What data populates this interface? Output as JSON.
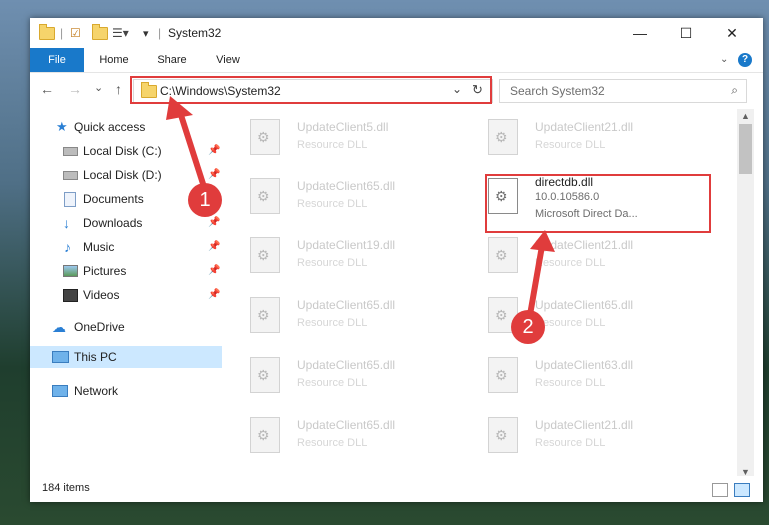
{
  "window": {
    "title": "System32"
  },
  "controls": {
    "minimize": "—",
    "maximize": "☐",
    "close": "✕"
  },
  "ribbon": {
    "tabs": [
      "File",
      "Home",
      "Share",
      "View"
    ],
    "help": "?"
  },
  "nav": {
    "back": "←",
    "forward": "→",
    "recent": "⌄",
    "up": "↑"
  },
  "address": {
    "path": "C:\\Windows\\System32"
  },
  "search": {
    "placeholder": "Search System32"
  },
  "sidebar": {
    "items": [
      {
        "label": "Quick access",
        "icon": "star-icon"
      },
      {
        "label": "Local Disk (C:)",
        "icon": "drive-icon"
      },
      {
        "label": "Local Disk (D:)",
        "icon": "drive-icon"
      },
      {
        "label": "Documents",
        "icon": "documents-icon"
      },
      {
        "label": "Downloads",
        "icon": "download-icon"
      },
      {
        "label": "Music",
        "icon": "music-icon"
      },
      {
        "label": "Pictures",
        "icon": "pictures-icon"
      },
      {
        "label": "Videos",
        "icon": "videos-icon"
      },
      {
        "label": "OneDrive",
        "icon": "cloud-icon"
      },
      {
        "label": "This PC",
        "icon": "computer-icon"
      },
      {
        "label": "Network",
        "icon": "network-icon"
      }
    ]
  },
  "files": {
    "left": [
      {
        "name": "UpdateClient5.dll",
        "desc": "Resource DLL"
      },
      {
        "name": "UpdateClient65.dll",
        "desc": "Resource DLL"
      },
      {
        "name": "UpdateClient19.dll",
        "desc": "Resource DLL"
      },
      {
        "name": "UpdateClient65.dll",
        "desc": "Resource DLL"
      },
      {
        "name": "UpdateClient65.dll",
        "desc": "Resource DLL"
      },
      {
        "name": "UpdateClient65.dll",
        "desc": "Resource DLL"
      }
    ],
    "right": [
      {
        "name": "UpdateClient21.dll",
        "desc": "Resource DLL"
      },
      {
        "name": "UpdateClient21.dll",
        "desc": "Resource DLL"
      },
      {
        "name": "UpdateClient65.dll",
        "desc": "Resource DLL"
      },
      {
        "name": "UpdateClient63.dll",
        "desc": "Resource DLL"
      },
      {
        "name": "UpdateClient21.dll",
        "desc": "Resource DLL"
      }
    ],
    "highlighted": {
      "name": "directdb.dll",
      "version": "10.0.10586.0",
      "desc": "Microsoft Direct Da..."
    }
  },
  "status": {
    "count": "184 items"
  },
  "callouts": [
    "1",
    "2"
  ],
  "colors": {
    "accent": "#1979ca",
    "highlight": "#e03c3c",
    "selected": "#cce8ff"
  }
}
